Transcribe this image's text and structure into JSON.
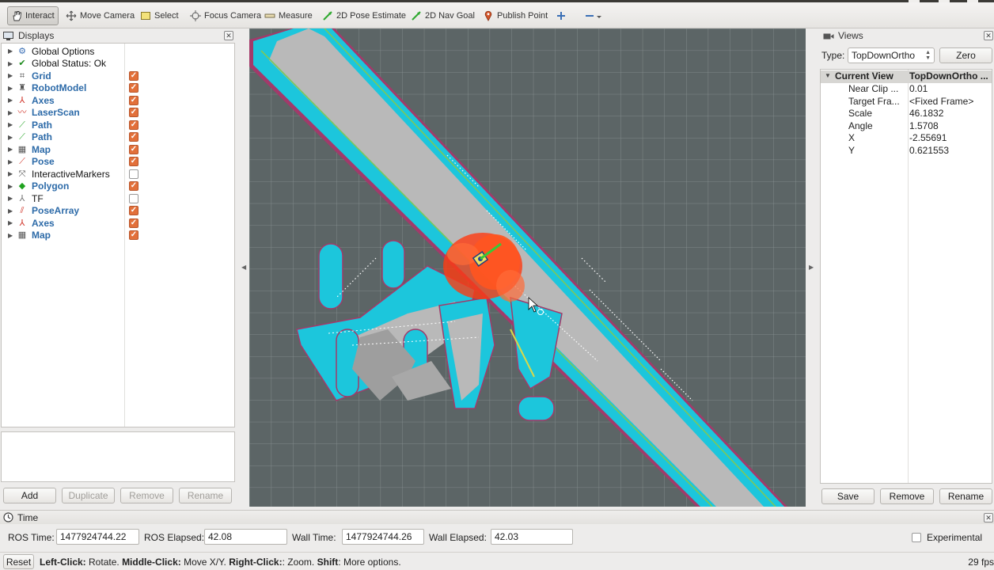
{
  "toolbar": {
    "items": [
      {
        "label": "Interact",
        "icon": "hand-icon"
      },
      {
        "label": "Move Camera",
        "icon": "move-camera-icon"
      },
      {
        "label": "Select",
        "icon": "select-icon"
      },
      {
        "label": "Focus Camera",
        "icon": "focus-camera-icon"
      },
      {
        "label": "Measure",
        "icon": "ruler-icon"
      },
      {
        "label": "2D Pose Estimate",
        "icon": "pose-estimate-arrow-icon"
      },
      {
        "label": "2D Nav Goal",
        "icon": "nav-goal-arrow-icon"
      },
      {
        "label": "Publish Point",
        "icon": "map-pin-icon"
      }
    ],
    "plus_icon": "plus-icon",
    "minus_icon": "minus-dropdown-icon"
  },
  "displays": {
    "title": "Displays",
    "items": [
      {
        "label": "Global Options",
        "icon": "gear-icon",
        "style": "black",
        "checkbox": null
      },
      {
        "label": "Global Status: Ok",
        "icon": "check-icon",
        "style": "black",
        "checkbox": null
      },
      {
        "label": "Grid",
        "icon": "grid-icon",
        "style": "blue",
        "checkbox": true
      },
      {
        "label": "RobotModel",
        "icon": "robot-icon",
        "style": "blue",
        "checkbox": true
      },
      {
        "label": "Axes",
        "icon": "axes-icon",
        "style": "blue",
        "checkbox": true
      },
      {
        "label": "LaserScan",
        "icon": "laserscan-icon",
        "style": "blue",
        "checkbox": true
      },
      {
        "label": "Path",
        "icon": "path-icon",
        "style": "blue",
        "checkbox": true
      },
      {
        "label": "Path",
        "icon": "path-icon",
        "style": "blue",
        "checkbox": true
      },
      {
        "label": "Map",
        "icon": "map-icon",
        "style": "blue",
        "checkbox": true
      },
      {
        "label": "Pose",
        "icon": "pose-icon",
        "style": "blue",
        "checkbox": true
      },
      {
        "label": "InteractiveMarkers",
        "icon": "interactive-markers-icon",
        "style": "black",
        "checkbox": false
      },
      {
        "label": "Polygon",
        "icon": "polygon-icon",
        "style": "blue",
        "checkbox": true
      },
      {
        "label": "TF",
        "icon": "tf-icon",
        "style": "black",
        "checkbox": false
      },
      {
        "label": "PoseArray",
        "icon": "posearray-icon",
        "style": "blue",
        "checkbox": true
      },
      {
        "label": "Axes",
        "icon": "axes-icon",
        "style": "blue",
        "checkbox": true
      },
      {
        "label": "Map",
        "icon": "map-icon",
        "style": "blue",
        "checkbox": true
      }
    ],
    "buttons": {
      "add": "Add",
      "duplicate": "Duplicate",
      "remove": "Remove",
      "rename": "Rename"
    }
  },
  "views": {
    "title": "Views",
    "type_label": "Type:",
    "type_value": "TopDownOrtho",
    "zero_button": "Zero",
    "current_view": {
      "key": "Current View",
      "value": "TopDownOrtho ..."
    },
    "properties": [
      {
        "key": "Near Clip ...",
        "value": "0.01"
      },
      {
        "key": "Target Fra...",
        "value": "<Fixed Frame>"
      },
      {
        "key": "Scale",
        "value": "46.1832"
      },
      {
        "key": "Angle",
        "value": "1.5708"
      },
      {
        "key": "X",
        "value": "-2.55691"
      },
      {
        "key": "Y",
        "value": "0.621553"
      }
    ],
    "buttons": {
      "save": "Save",
      "remove": "Remove",
      "rename": "Rename"
    }
  },
  "time": {
    "title": "Time",
    "ros_time_label": "ROS Time:",
    "ros_time": "1477924744.22",
    "ros_elapsed_label": "ROS Elapsed:",
    "ros_elapsed": "42.08",
    "wall_time_label": "Wall Time:",
    "wall_time": "1477924744.26",
    "wall_elapsed_label": "Wall Elapsed:",
    "wall_elapsed": "42.03",
    "experimental_label": "Experimental",
    "experimental_checked": false
  },
  "status": {
    "reset": "Reset",
    "left_click_key": "Left-Click:",
    "left_click_text": "Rotate.",
    "middle_click_key": "Middle-Click:",
    "middle_click_text": "Move X/Y.",
    "right_click_key": "Right-Click:",
    "right_click_text": ": Zoom.",
    "shift_key": "Shift",
    "shift_text": ": More options.",
    "fps": "29 fps"
  },
  "colors": {
    "grid_background": "#5c6566",
    "costmap_cyan": "#1cc6dc",
    "free_space": "#b9b9b9",
    "inflation_border": "#a23a6a",
    "path_line": "#6fe06a",
    "particle_cloud": "#ff3b12",
    "checkbox_orange": "#e2703a"
  }
}
